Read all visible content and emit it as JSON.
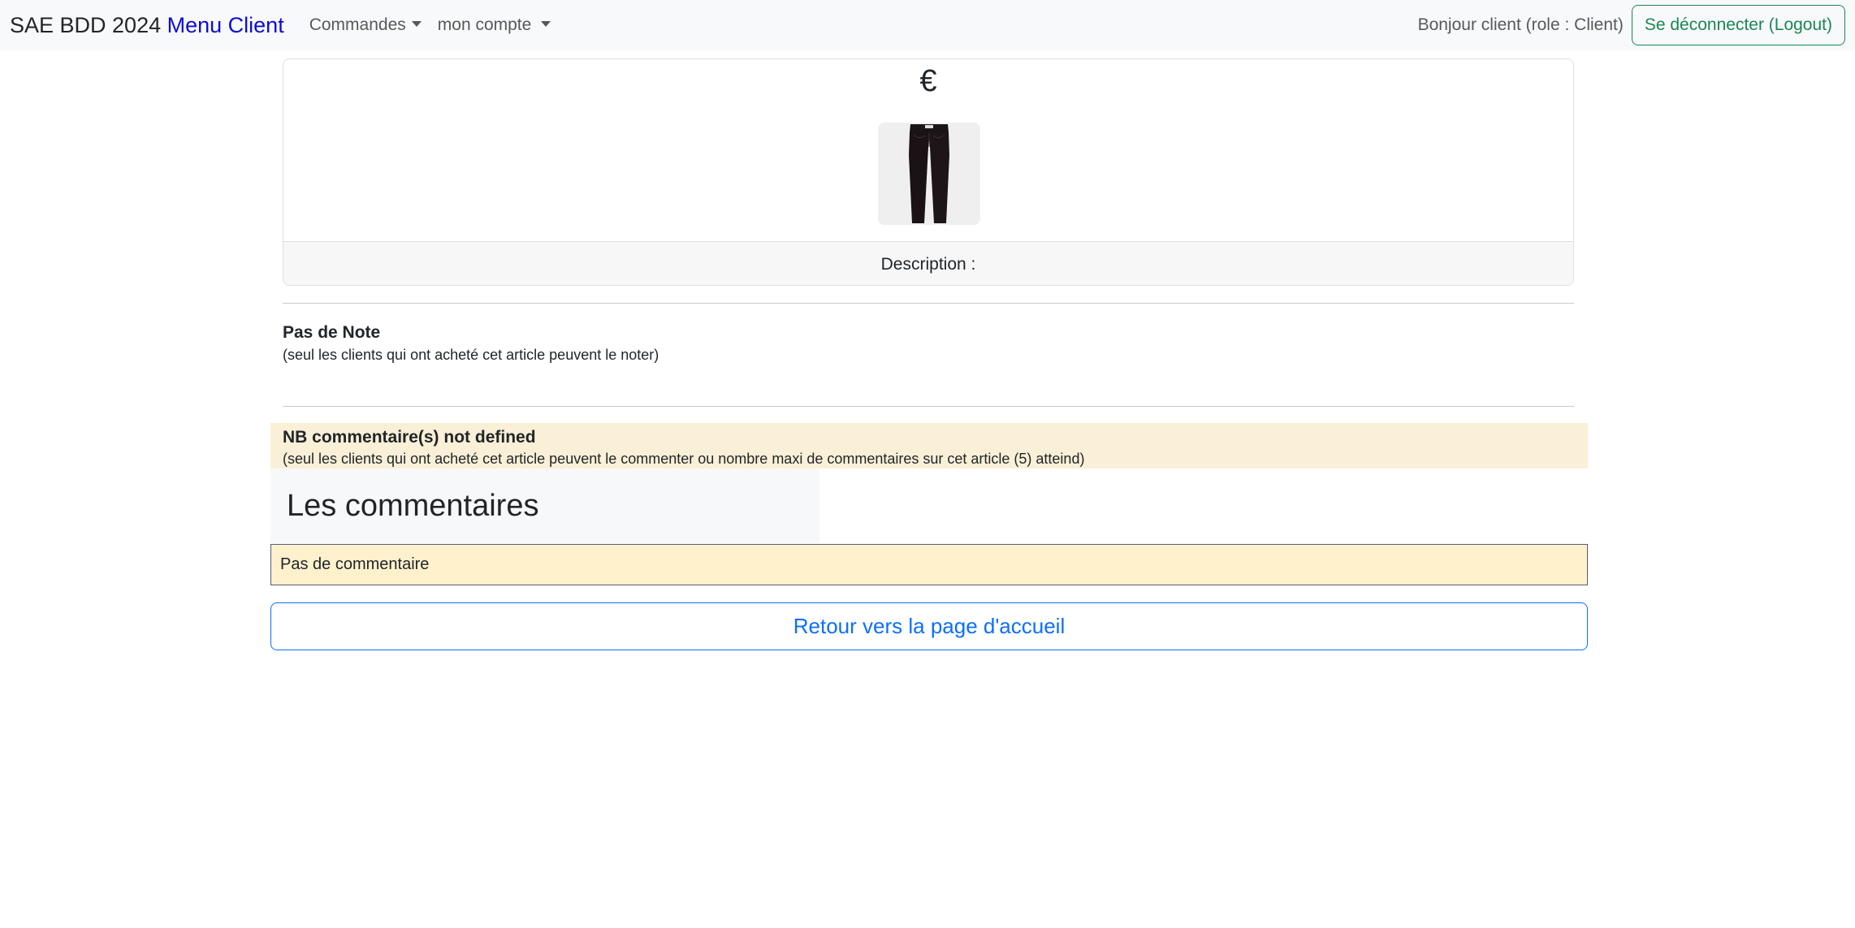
{
  "navbar": {
    "brand": "SAE BDD 2024",
    "menu_client": "Menu Client",
    "commandes_label": "Commandes",
    "compte_label": "mon compte",
    "greeting": "Bonjour client (role : Client)",
    "logout_label": "Se déconnecter (Logout)"
  },
  "article": {
    "price": "€",
    "image_alt": "black pants",
    "description_label": "Description :"
  },
  "note": {
    "title": "Pas de Note",
    "subtitle": "(seul les clients qui ont acheté cet article peuvent le noter)"
  },
  "comments": {
    "alert_title": "NB commentaire(s) not defined",
    "alert_subtitle": "(seul les clients qui ont acheté cet article peuvent le commenter ou nombre maxi de commentaires sur cet article (5) atteind)",
    "header": "Les commentaires",
    "empty": "Pas de commentaire"
  },
  "actions": {
    "home_button": "Retour vers la page d'accueil"
  },
  "colors": {
    "brand_link": "#0d0dd6",
    "success": "#198754",
    "primary": "#0d6efd",
    "warning_bg": "#faf0d7"
  }
}
